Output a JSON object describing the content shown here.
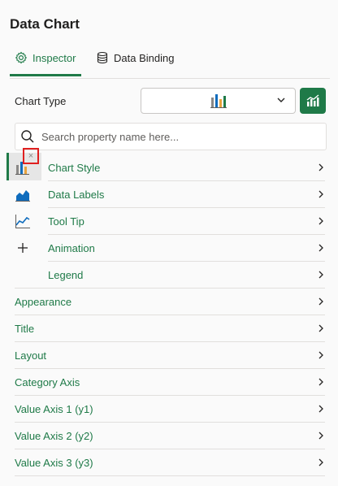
{
  "header": {
    "title": "Data Chart"
  },
  "tabs": {
    "inspector": "Inspector",
    "data_binding": "Data Binding"
  },
  "chart_type": {
    "label": "Chart Type"
  },
  "search": {
    "placeholder": "Search property name here..."
  },
  "sections_sub": [
    {
      "label": "Chart Style"
    },
    {
      "label": "Data Labels"
    },
    {
      "label": "Tool Tip"
    },
    {
      "label": "Animation"
    },
    {
      "label": "Legend"
    }
  ],
  "sections_top": [
    {
      "label": "Appearance"
    },
    {
      "label": "Title"
    },
    {
      "label": "Layout"
    },
    {
      "label": "Category Axis"
    },
    {
      "label": "Value Axis 1 (y1)"
    },
    {
      "label": "Value Axis 2 (y2)"
    },
    {
      "label": "Value Axis 3 (y3)"
    }
  ],
  "close_glyph": "×",
  "colors": {
    "accent": "#1f7a48",
    "highlight": "#e02020"
  }
}
